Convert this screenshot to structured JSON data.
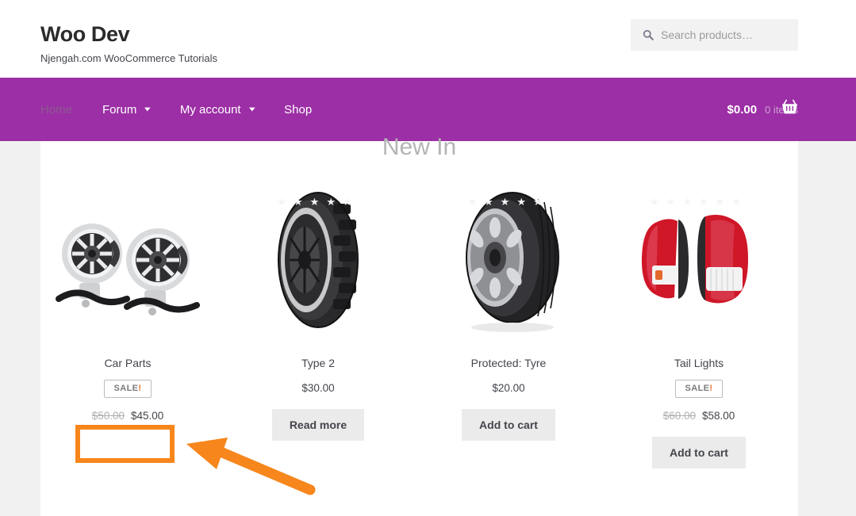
{
  "header": {
    "site_title": "Woo Dev",
    "tagline": "Njengah.com WooCommerce Tutorials",
    "search": {
      "placeholder": "Search products…",
      "value": "",
      "icon": "search-icon"
    }
  },
  "nav": {
    "background_color": "#9c2fa5",
    "items": [
      {
        "label": "Home",
        "has_dropdown": false,
        "current": true
      },
      {
        "label": "Forum",
        "has_dropdown": true,
        "current": false
      },
      {
        "label": "My account",
        "has_dropdown": true,
        "current": false
      },
      {
        "label": "Shop",
        "has_dropdown": false,
        "current": false
      }
    ],
    "cart": {
      "amount": "$0.00",
      "items": "0 items",
      "icon": "shopping-basket-icon"
    }
  },
  "main": {
    "heading": "New In",
    "products": [
      {
        "title": "Car Parts",
        "image": "car-audio-speakers",
        "on_sale": true,
        "sale_label": "SALE",
        "sale_mark": "!",
        "old_price": "$50.00",
        "price": "$45.00",
        "button": null,
        "show_stars": false
      },
      {
        "title": "Type 2",
        "image": "off-road-tyre",
        "on_sale": false,
        "sale_label": "",
        "sale_mark": "",
        "old_price": "",
        "price": "$30.00",
        "button": "Read more",
        "show_stars": true
      },
      {
        "title": "Protected: Tyre",
        "image": "alloy-wheel-tyre",
        "on_sale": false,
        "sale_label": "",
        "sale_mark": "",
        "old_price": "",
        "price": "$20.00",
        "button": "Add to cart",
        "show_stars": true
      },
      {
        "title": "Tail Lights",
        "image": "car-tail-lights",
        "on_sale": true,
        "sale_label": "SALE",
        "sale_mark": "!",
        "old_price": "$60.00",
        "price": "$58.00",
        "button": "Add to cart",
        "show_stars": true
      }
    ]
  },
  "annotation": {
    "color": "#f7861c",
    "shape": "empty-rectangle-with-arrow",
    "target_product": "Car Parts"
  },
  "colors": {
    "page_background": "#f1f1f1",
    "content_background": "#ffffff",
    "accent_purple": "#9c2fa5",
    "annotation_orange": "#f7861c",
    "sale_orange": "#e8762c",
    "button_grey": "#ebebeb"
  }
}
